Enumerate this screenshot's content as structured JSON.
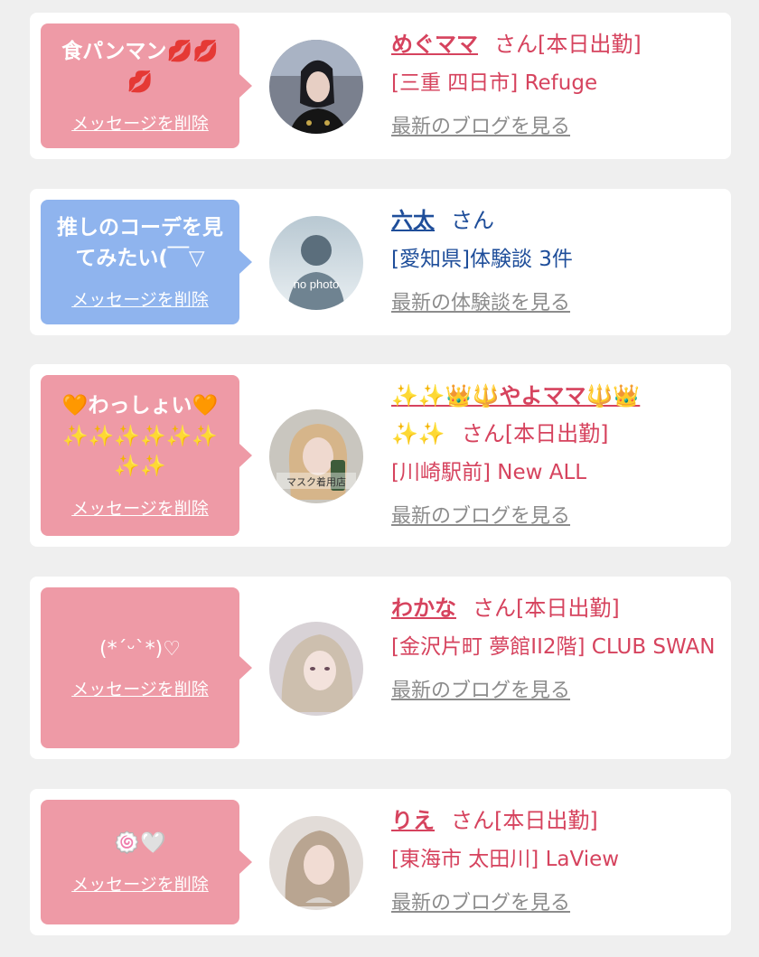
{
  "cards": [
    {
      "message": "食パンマン",
      "message_extra": "💋💋💋",
      "delete_label": "メッセージを削除",
      "name": "めぐママ",
      "suffix": "さん[本日出勤]",
      "shop": "[三重 四日市] Refuge",
      "link": "最新のブログを見る"
    },
    {
      "message": "推しのコーデを見てみたい(￣▽",
      "delete_label": "メッセージを削除",
      "name": "六太",
      "suffix": "さん",
      "shop": "[愛知県]体験談 3件",
      "avatar_text": "no photo",
      "link": "最新の体験談を見る"
    },
    {
      "message_pre": "🧡",
      "message": "わっしょい",
      "message_post": "🧡",
      "message_extra": "✨✨✨✨✨✨✨✨",
      "delete_label": "メッセージを削除",
      "name_prefix": "✨✨👑🔱",
      "name": "やよママ",
      "name_suffix": "🔱👑",
      "name_tail": "✨✨",
      "suffix": "さん[本日出勤]",
      "shop": "[川崎駅前] New ALL",
      "avatar_text": "マスク着用店",
      "link": "最新のブログを見る"
    },
    {
      "message": "(*ˊᵕˋ*)♡",
      "delete_label": "メッセージを削除",
      "name": "わかな",
      "suffix": "さん[本日出勤]",
      "shop": "[金沢片町 夢館II2階] CLUB SWAN",
      "link": "最新のブログを見る"
    },
    {
      "message": "🍥🤍",
      "delete_label": "メッセージを削除",
      "name": "りえ",
      "suffix": "さん[本日出勤]",
      "shop": "[東海市 太田川] LaView",
      "link": "最新のブログを見る"
    }
  ]
}
